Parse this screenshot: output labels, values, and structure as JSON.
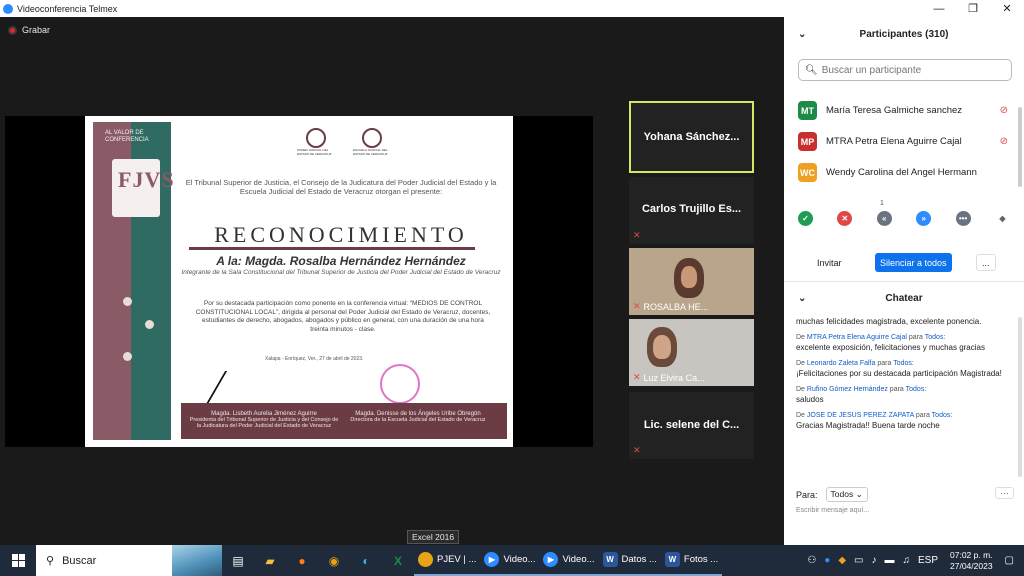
{
  "window": {
    "title": "Videoconferencia Telmex",
    "controls": [
      "—",
      "❐",
      "✕"
    ]
  },
  "meeting": {
    "record_label": "Grabar"
  },
  "certificate": {
    "band_text": "AL VALOR DE CONFERENCIA",
    "monogram": "FJVS",
    "seal_left": "PODER JUDICIAL DEL ESTADO DE VERACRUZ",
    "seal_right": "ESCUELA JUDICIAL DEL ESTADO DE VERACRUZ",
    "intro": "El Tribunal Superior de Justicia, el Consejo de la Judicatura del Poder Judicial del Estado y la Escuela Judicial del Estado de Veracruz otorgan el presente:",
    "heading": "RECONOCIMIENTO",
    "honoree": "A la: Magda. Rosalba Hernández Hernández",
    "role": "Integrante de la Sala Constitucional del Tribunal Superior de Justicia del Poder Judicial del Estado de Veracruz",
    "body": "Por su destacada participación como ponente en la conferencia virtual: “MEDIOS DE CONTROL CONSTITUCIONAL LOCAL”, dirigida al personal del Poder Judicial del Estado de Veracruz, docentes, estudiantes de derecho, abogados, abogados y público en general, con una duración de una hora treinta minutos - clase.",
    "date": "Xalapa - Enríquez, Ver., 27 de abril de 2023.",
    "signer_left": "Magda. Lisbeth Aurelia Jiménez Aguirre",
    "signer_left_role": "Presidenta del Tribunal Superior de Justicia y del Consejo de la Judicatura del Poder Judicial del Estado de Veracruz",
    "signer_right": "Magda. Denisse de los Ángeles Uribe Obregón",
    "signer_right_role": "Directora de la Escuela Judicial del Estado de Veracruz"
  },
  "gallery": {
    "tiles": [
      {
        "name": "Yohana Sánchez..."
      },
      {
        "name": "Carlos Trujillo Es..."
      },
      {
        "name": "ROSALBA HE..."
      },
      {
        "name": "Luz Elvira Ca..."
      },
      {
        "name": "Lic. selene del C..."
      }
    ]
  },
  "participants": {
    "title": "Participantes (310)",
    "search_placeholder": "Buscar un participante",
    "items": [
      {
        "initials": "MT",
        "name": "María Teresa Galmiche sanchez",
        "color": "#1f8a47"
      },
      {
        "initials": "MP",
        "name": "MTRA Petra  Elena Aguirre Cajal",
        "color": "#c8302f"
      },
      {
        "initials": "WC",
        "name": "Wendy Carolina del Angel Hermann",
        "color": "#f0a020"
      }
    ],
    "reaction_count": "1",
    "invite_label": "Invitar",
    "mute_all_label": "Silenciar a todos",
    "more_label": "..."
  },
  "chat": {
    "title": "Chatear",
    "messages": [
      {
        "from": "",
        "to": "",
        "text": "muchas felicidades magistrada, excelente ponencia."
      },
      {
        "from": "MTRA Petra  Elena Aguirre Cajal",
        "to": "Todos",
        "text": "excelente exposición, felicitaciones y muchas gracias"
      },
      {
        "from": "Leonardo Zaleta Falfa",
        "to": "Todos",
        "text": "¡Felicitaciones por su destacada participación Magistrada!"
      },
      {
        "from": "Rufino Gómez Hernández",
        "to": "Todos",
        "text": "saludos"
      },
      {
        "from": "JOSE DE JESUS PEREZ ZAPATA",
        "to": "Todos",
        "text": "Gracias Magistrada!! Buena tarde noche"
      }
    ],
    "de_label": "De",
    "para_label": "para",
    "to_label": "Para:",
    "to_value": "Todos",
    "compose_placeholder": "Escribir mensaje aquí..."
  },
  "tooltip": "Excel 2016",
  "taskbar": {
    "search_label": "Buscar",
    "apps": [
      {
        "label": "PJEV | ...",
        "icon_color": "#e8a317",
        "icon": "chrome-icon"
      },
      {
        "label": "Video...",
        "icon_color": "#2d8cff",
        "icon": "video-icon"
      },
      {
        "label": "Video...",
        "icon_color": "#2d8cff",
        "icon": "video-icon"
      },
      {
        "label": "Datos ...",
        "icon_color": "#2b579a",
        "icon": "word-icon"
      },
      {
        "label": "Fotos ...",
        "icon_color": "#2b579a",
        "icon": "word-icon"
      }
    ],
    "lang": "ESP",
    "time": "07:02 p. m.",
    "date": "27/04/2023"
  }
}
